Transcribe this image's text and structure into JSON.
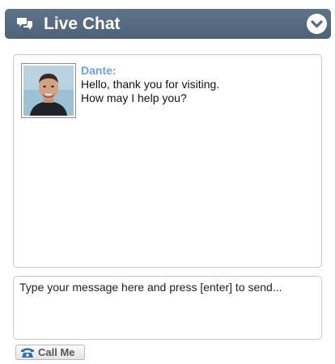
{
  "header": {
    "title": "Live Chat",
    "icons": {
      "chat": "chat-bubbles-icon",
      "collapse": "chevron-down-circle-icon"
    },
    "colors": {
      "background": "#56697f",
      "text": "#ffffff"
    }
  },
  "messages": [
    {
      "sender": "Dante:",
      "avatar": "agent-avatar",
      "lines": [
        "Hello, thank you for visiting.",
        "How may I help you?"
      ],
      "sender_color": "#6f9fe0"
    }
  ],
  "input": {
    "placeholder": "Type your message here and press [enter] to send...",
    "value": ""
  },
  "call_button": {
    "label": "Call Me",
    "icon": "telephone-icon",
    "icon_color": "#2f6fb0"
  }
}
